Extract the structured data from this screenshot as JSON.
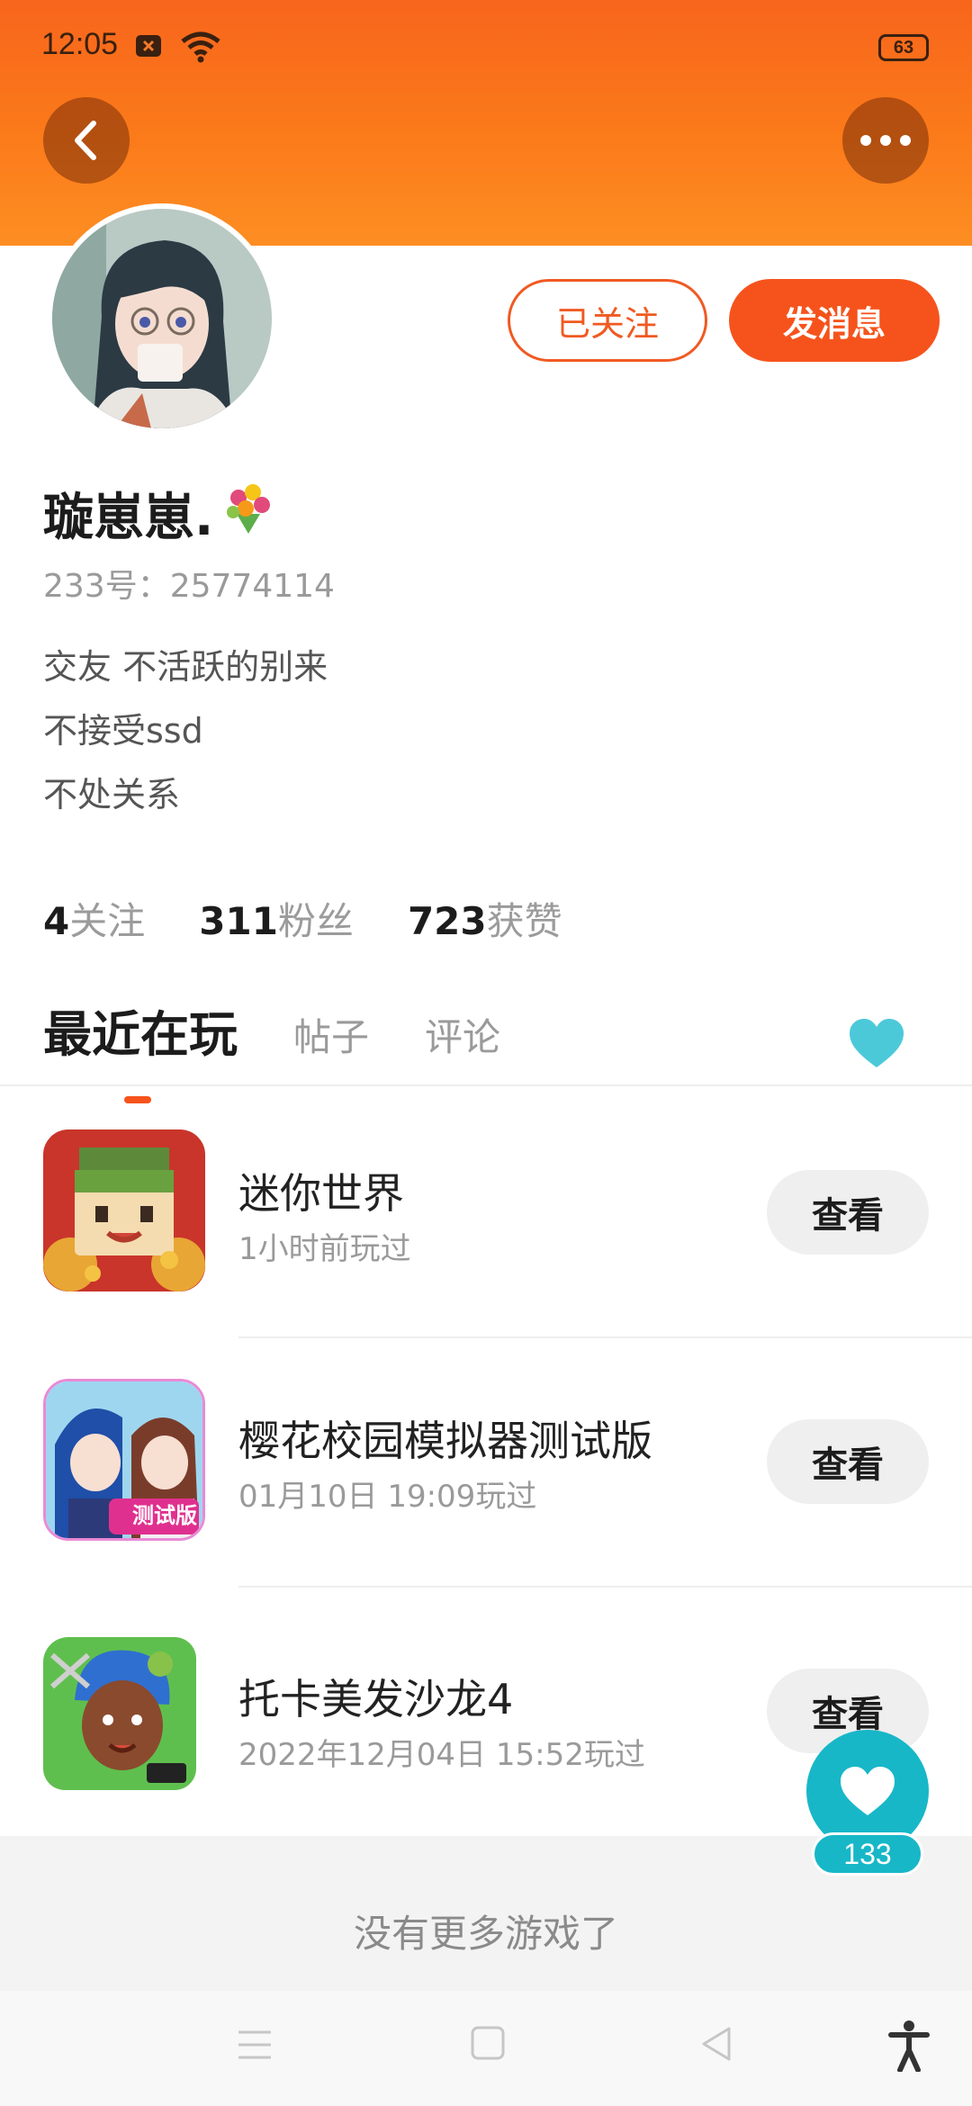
{
  "status_bar": {
    "time": "12:05",
    "battery": "63"
  },
  "header": {
    "back_icon": "back-chevron-icon",
    "more_icon": "more-dots-icon"
  },
  "profile": {
    "name": "璇崽崽.",
    "id_line": "233号：25774114",
    "bio": [
      "交友 不活跃的别来",
      "不接受ssd",
      "不处关系"
    ],
    "follow_label": "已关注",
    "message_label": "发消息"
  },
  "stats": {
    "following": {
      "value": "4",
      "label": "关注"
    },
    "fans": {
      "value": "311",
      "label": "粉丝"
    },
    "likes": {
      "value": "723",
      "label": "获赞"
    }
  },
  "tabs": {
    "recent": "最近在玩",
    "posts": "帖子",
    "comments": "评论"
  },
  "games": [
    {
      "name": "迷你世界",
      "time": "1小时前玩过",
      "action": "查看"
    },
    {
      "name": "樱花校园模拟器测试版",
      "time": "01月10日 19:09玩过",
      "action": "查看",
      "badge": "测试版"
    },
    {
      "name": "托卡美发沙龙4",
      "time": "2022年12月04日 15:52玩过",
      "action": "查看"
    }
  ],
  "footer": {
    "no_more": "没有更多游戏了"
  },
  "like_button": {
    "count": "133"
  },
  "colors": {
    "accent": "#f6531c",
    "teal": "#17b7c8"
  }
}
